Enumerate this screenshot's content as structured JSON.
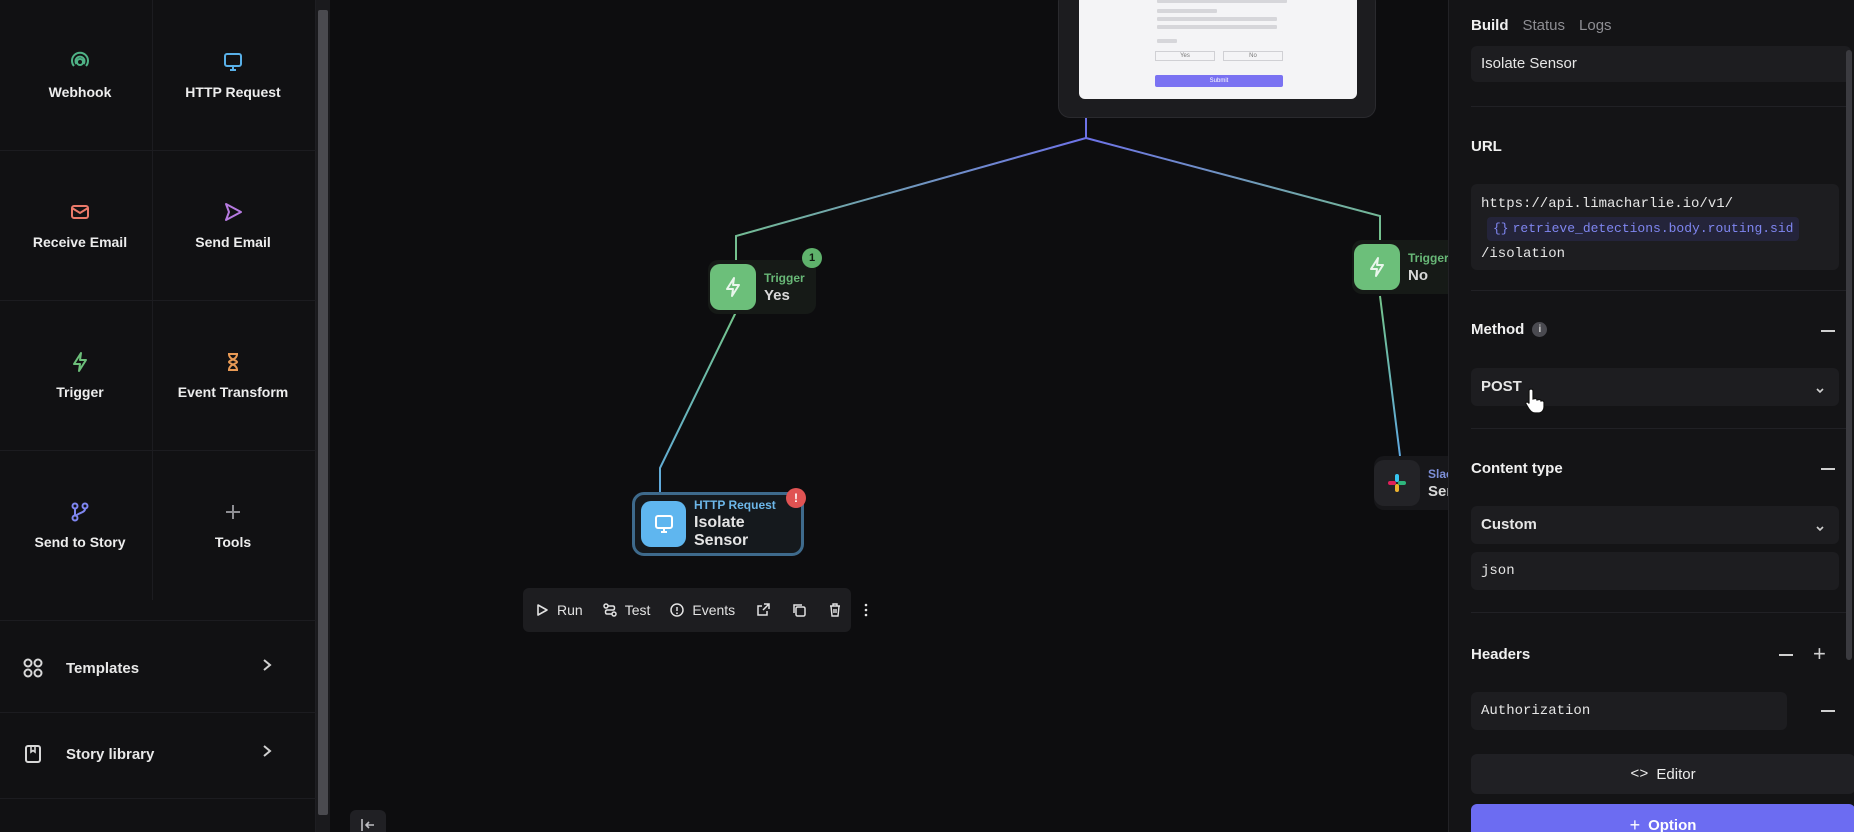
{
  "palette": {
    "tiles": [
      {
        "label": "Webhook",
        "icon": "webhook-icon",
        "color": "#4fb286"
      },
      {
        "label": "HTTP Request",
        "icon": "monitor-icon",
        "color": "#59b0e8"
      },
      {
        "label": "Receive Email",
        "icon": "mail-icon",
        "color": "#ea7a6a"
      },
      {
        "label": "Send Email",
        "icon": "send-icon",
        "color": "#b67ae0"
      },
      {
        "label": "Trigger",
        "icon": "lightning-icon",
        "color": "#6cbf7a"
      },
      {
        "label": "Event Transform",
        "icon": "hourglass-icon",
        "color": "#e89a55"
      },
      {
        "label": "Send to Story",
        "icon": "branch-icon",
        "color": "#7f86f0"
      },
      {
        "label": "Tools",
        "icon": "plus-icon",
        "color": "#8e8e93"
      }
    ],
    "links": [
      {
        "label": "Templates",
        "icon": "grid-icon"
      },
      {
        "label": "Story library",
        "icon": "book-icon"
      }
    ]
  },
  "canvas": {
    "trigger_yes": {
      "type": "Trigger",
      "name": "Yes",
      "badge": "1"
    },
    "trigger_no": {
      "type": "Trigger",
      "name": "No"
    },
    "http_node": {
      "type": "HTTP Request",
      "name": "Isolate Sensor",
      "error_badge": "!"
    },
    "slack_node": {
      "type": "Slac",
      "name": "Ser"
    },
    "form_preview": {
      "submit_label": "Submit",
      "yes": "Yes",
      "no": "No"
    },
    "toolbar": {
      "run": "Run",
      "test": "Test",
      "events": "Events"
    }
  },
  "panel": {
    "tabs": [
      "Build",
      "Status",
      "Logs"
    ],
    "name_value": "Isolate Sensor",
    "url_label": "URL",
    "url_prefix": "https://api.limacharlie.io/v1/",
    "url_var": "retrieve_detections.body.routing.sid",
    "url_suffix": "/isolation",
    "method_label": "Method",
    "method_value": "POST",
    "content_type_label": "Content type",
    "content_type_value": "Custom",
    "content_type_custom": "json",
    "headers_label": "Headers",
    "header_key": "Authorization",
    "editor_label": "Editor",
    "option_label": "Option"
  },
  "colors": {
    "accent": "#6c6cf2",
    "trigger": "#6cbf7a",
    "http": "#5fb6ef",
    "error": "#e05353"
  }
}
